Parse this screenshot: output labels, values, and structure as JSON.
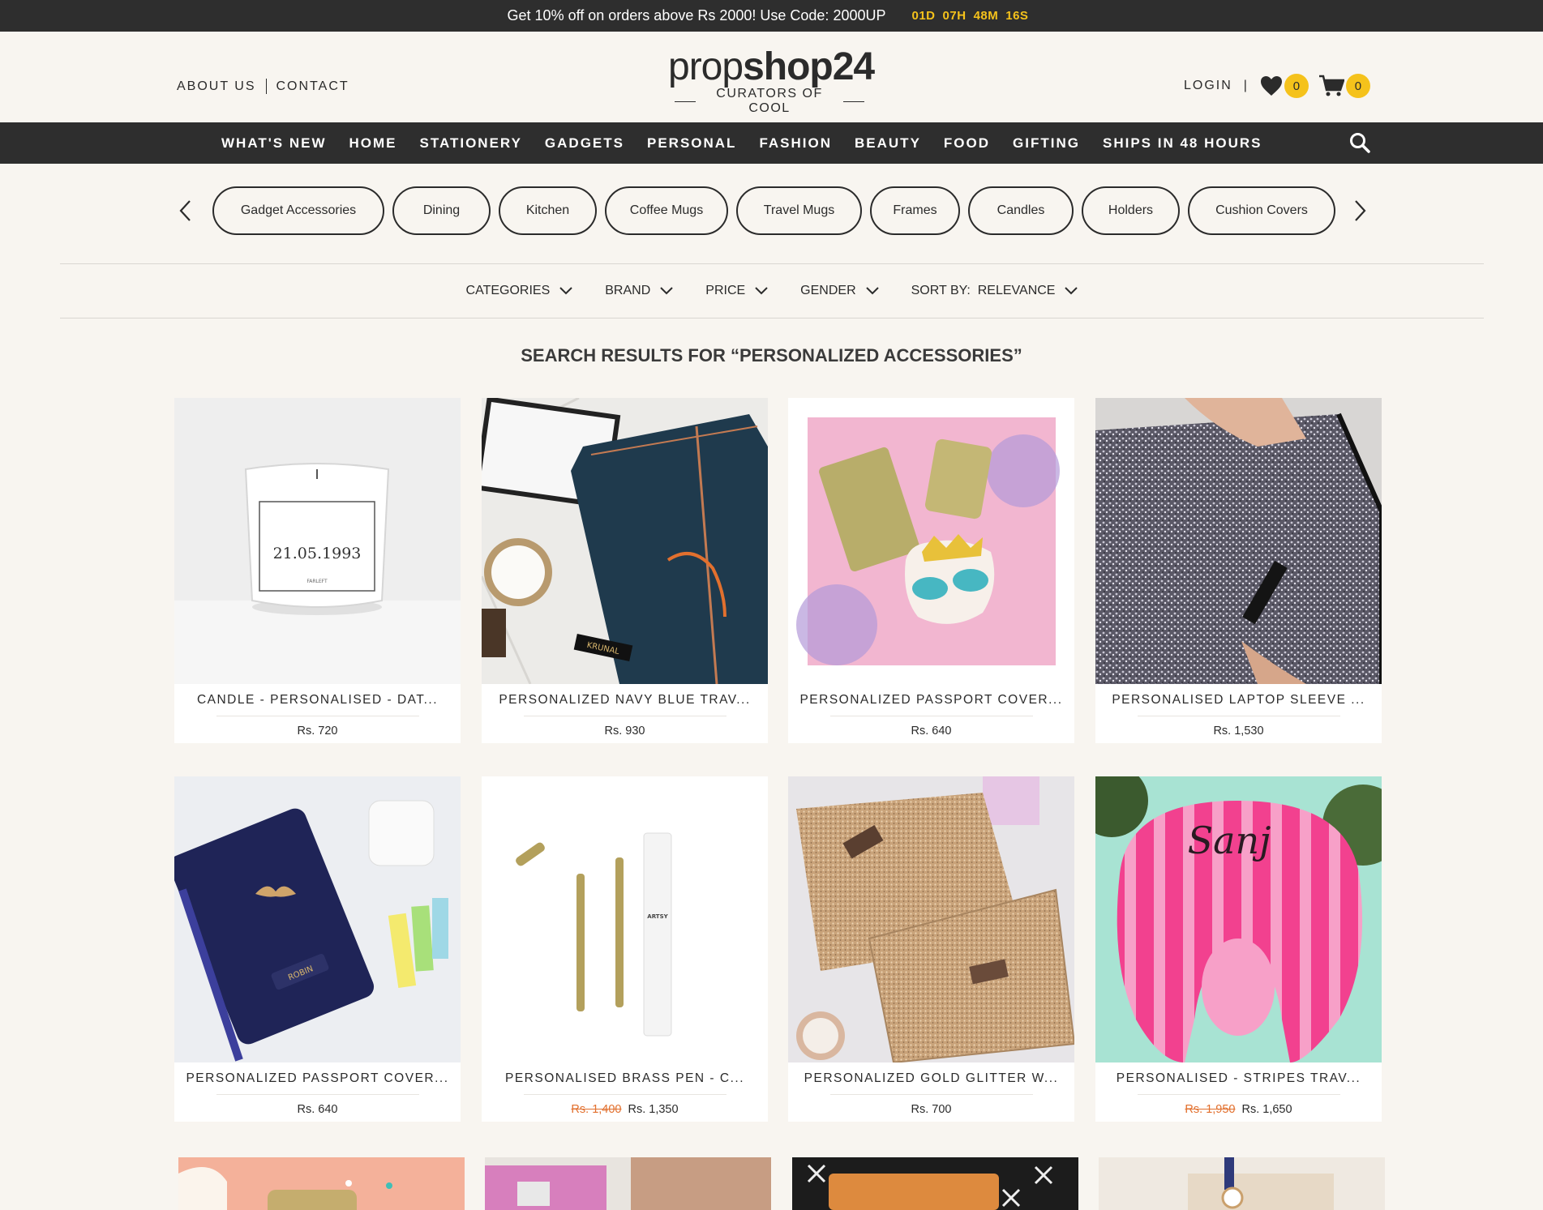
{
  "announcement": {
    "message": "Get 10% off on orders above Rs 2000! Use Code: 2000UP",
    "timer": [
      "01D",
      "07H",
      "48M",
      "16S"
    ]
  },
  "header": {
    "links": {
      "about": "ABOUT US",
      "contact": "CONTACT"
    },
    "logo": {
      "word_thin": "prop",
      "word_bold": "shop24",
      "tagline": "CURATORS OF COOL"
    },
    "login": "LOGIN",
    "divider": "|",
    "wishlist_count": "0",
    "cart_count": "0"
  },
  "nav": {
    "items": [
      "WHAT'S NEW",
      "HOME",
      "STATIONERY",
      "GADGETS",
      "PERSONAL",
      "FASHION",
      "BEAUTY",
      "FOOD",
      "GIFTING",
      "SHIPS IN 48 HOURS"
    ]
  },
  "chips": [
    "Gadget Accessories",
    "Dining",
    "Kitchen",
    "Coffee Mugs",
    "Travel Mugs",
    "Frames",
    "Candles",
    "Holders",
    "Cushion Covers"
  ],
  "filters": {
    "categories": "CATEGORIES",
    "brand": "BRAND",
    "price": "PRICE",
    "gender": "GENDER",
    "sort_label": "SORT BY:",
    "sort_value": "RELEVANCE"
  },
  "results_title": "SEARCH RESULTS FOR “PERSONALIZED ACCESSORIES”",
  "products": [
    {
      "name": "CANDLE - PERSONALISED - DAT...",
      "price": "Rs. 720",
      "old_price": "",
      "image": "candle",
      "candle_text": "21.05.1993",
      "candle_brand": "FARLEFT"
    },
    {
      "name": "PERSONALIZED NAVY BLUE TRAV...",
      "price": "Rs. 930",
      "old_price": "",
      "image": "navy-journal",
      "journal_name": "KRUNAL"
    },
    {
      "name": "PERSONALIZED PASSPORT COVER...",
      "price": "Rs. 640",
      "old_price": "",
      "image": "gold-passport-set"
    },
    {
      "name": "PERSONALISED LAPTOP SLEEVE ...",
      "price": "Rs. 1,530",
      "old_price": "",
      "image": "glitter-sleeve"
    },
    {
      "name": "PERSONALIZED PASSPORT COVER...",
      "price": "Rs. 640",
      "old_price": "",
      "image": "navy-passport",
      "passport_name": "ROBIN"
    },
    {
      "name": "PERSONALISED BRASS PEN - C...",
      "price": "Rs. 1,350",
      "old_price": "Rs. 1,400",
      "image": "brass-pen",
      "pen_brand": "ARTSY"
    },
    {
      "name": "PERSONALIZED GOLD GLITTER W...",
      "price": "Rs. 700",
      "old_price": "",
      "image": "gold-pouch"
    },
    {
      "name": "PERSONALISED - STRIPES TRAV...",
      "price": "Rs. 1,650",
      "old_price": "Rs. 1,950",
      "image": "pink-pillow",
      "pillow_name": "Sanj"
    }
  ],
  "colors": {
    "dark": "#2e2e2e",
    "accent": "#f5c21b",
    "sale": "#e2702e",
    "background": "#f8f5f0"
  }
}
